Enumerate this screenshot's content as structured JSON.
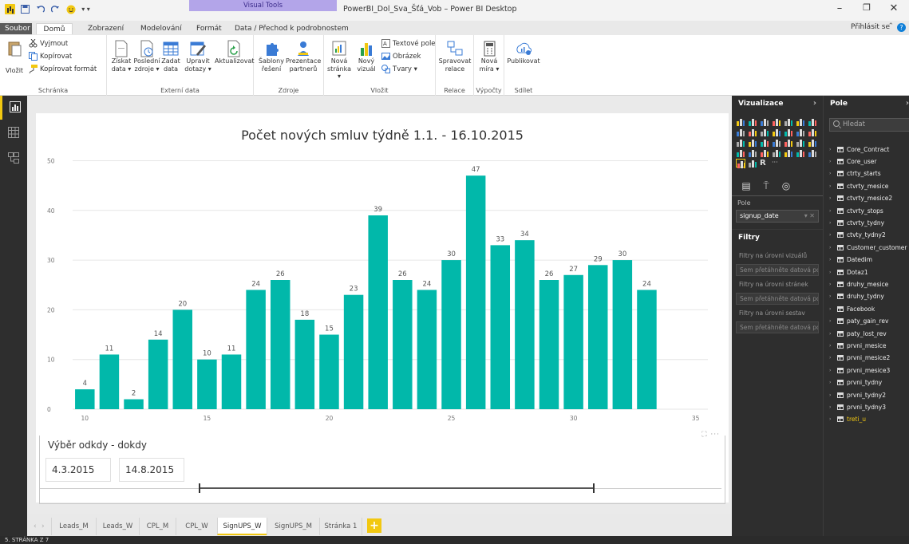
{
  "window": {
    "title": "PowerBI_Dol_Sva_Šťá_Vob – Power BI Desktop",
    "context_tab_group": "Visual Tools"
  },
  "ribbon_tabs": {
    "file": "Soubor",
    "home": "Domů",
    "view": "Zobrazení",
    "modeling": "Modelování",
    "format": "Formát",
    "data_drill": "Data / Přechod k podrobnostem"
  },
  "signin": "Přihlásit se",
  "ribbon": {
    "clipboard": {
      "label": "Schránka",
      "paste": "Vložit",
      "cut": "Vyjmout",
      "copy": "Kopírovat",
      "format_painter": "Kopírovat formát"
    },
    "external": {
      "label": "Externí data",
      "get_data": [
        "Získat",
        "data ▾"
      ],
      "recent": [
        "Poslední",
        "zdroje ▾"
      ],
      "enter": [
        "Zadat",
        "data"
      ],
      "edit": [
        "Upravit",
        "dotazy ▾"
      ],
      "refresh": "Aktualizovat"
    },
    "resources": {
      "label": "Zdroje",
      "templates": [
        "Šablony",
        "řešení"
      ],
      "partners": [
        "Prezentace",
        "partnerů"
      ]
    },
    "insert": {
      "label": "Vložit",
      "new_page": [
        "Nová",
        "stránka ▾"
      ],
      "new_visual": [
        "Nový",
        "vizuál"
      ],
      "textbox": "Textové pole",
      "image": "Obrázek",
      "shapes": "Tvary ▾"
    },
    "relations": {
      "label": "Relace",
      "manage": [
        "Spravovat",
        "relace"
      ]
    },
    "calc": {
      "label": "Výpočty",
      "measure": [
        "Nová",
        "míra ▾"
      ]
    },
    "share": {
      "label": "Sdílet",
      "publish": "Publikovat"
    }
  },
  "chart_data": {
    "type": "bar",
    "title": "Počet nových smluv týdně 1.1. - 16.10.2015",
    "x": [
      10,
      11,
      12,
      13,
      14,
      15,
      16,
      17,
      18,
      19,
      20,
      21,
      22,
      23,
      24,
      25,
      26,
      27,
      28,
      29,
      30,
      31,
      32,
      33
    ],
    "values": [
      4,
      11,
      2,
      14,
      20,
      10,
      11,
      24,
      26,
      18,
      15,
      23,
      39,
      26,
      24,
      30,
      47,
      33,
      34,
      26,
      27,
      29,
      30,
      24
    ],
    "xticks": [
      10,
      15,
      20,
      25,
      30,
      35
    ],
    "yticks": [
      0,
      10,
      20,
      30,
      40,
      50
    ],
    "xlim": [
      9.5,
      35.5
    ],
    "ylim": [
      0,
      52
    ],
    "bar_color": "#01b8aa",
    "grid": true,
    "data_labels": true
  },
  "slicer": {
    "title": "Výběr odkdy - dokdy",
    "start": "4.3.2015",
    "end": "14.8.2015",
    "handle_start": 0.232,
    "handle_end": 0.81
  },
  "page_tabs": [
    "Leads_M",
    "Leads_W",
    "CPL_M",
    "CPL_W",
    "SignUPS_W",
    "SignUPS_M",
    "Stránka 1"
  ],
  "active_page": "SignUPS_W",
  "add_page": "+",
  "status": "5. STRÁNKA Z 7",
  "viz_pane": {
    "title": "Vizualizace",
    "field_well_label": "Pole",
    "field_value": "signup_date",
    "filters_title": "Filtry",
    "filter_visual": "Filtry na úrovni vizuálů",
    "filter_drop": "Sem přetáhněte datová po...",
    "filter_page": "Filtry na úrovni stránek",
    "filter_report": "Filtry na úrovni sestav"
  },
  "fields_pane": {
    "title": "Pole",
    "search_placeholder": "Hledat",
    "tables": [
      "Core_Contract",
      "Core_user",
      "ctrty_starts",
      "ctvrty_mesice",
      "ctvrty_mesice2",
      "ctvrty_stops",
      "ctvrty_tydny",
      "ctvty_tydny2",
      "Customer_customer",
      "Datedim",
      "Dotaz1",
      "druhy_mesice",
      "druhy_tydny",
      "Facebook",
      "paty_gain_rev",
      "paty_lost_rev",
      "prvni_mesice",
      "prvni_mesice2",
      "prvni_mesice3",
      "prvni_tydny",
      "prvni_tydny2",
      "prvni_tydny3",
      "treti_u"
    ],
    "highlighted": "treti_u"
  },
  "colors": {
    "accent": "#f2c811",
    "bar": "#01b8aa",
    "pane": "#2e2e2e",
    "visual_tools": "#b3a5e9"
  }
}
